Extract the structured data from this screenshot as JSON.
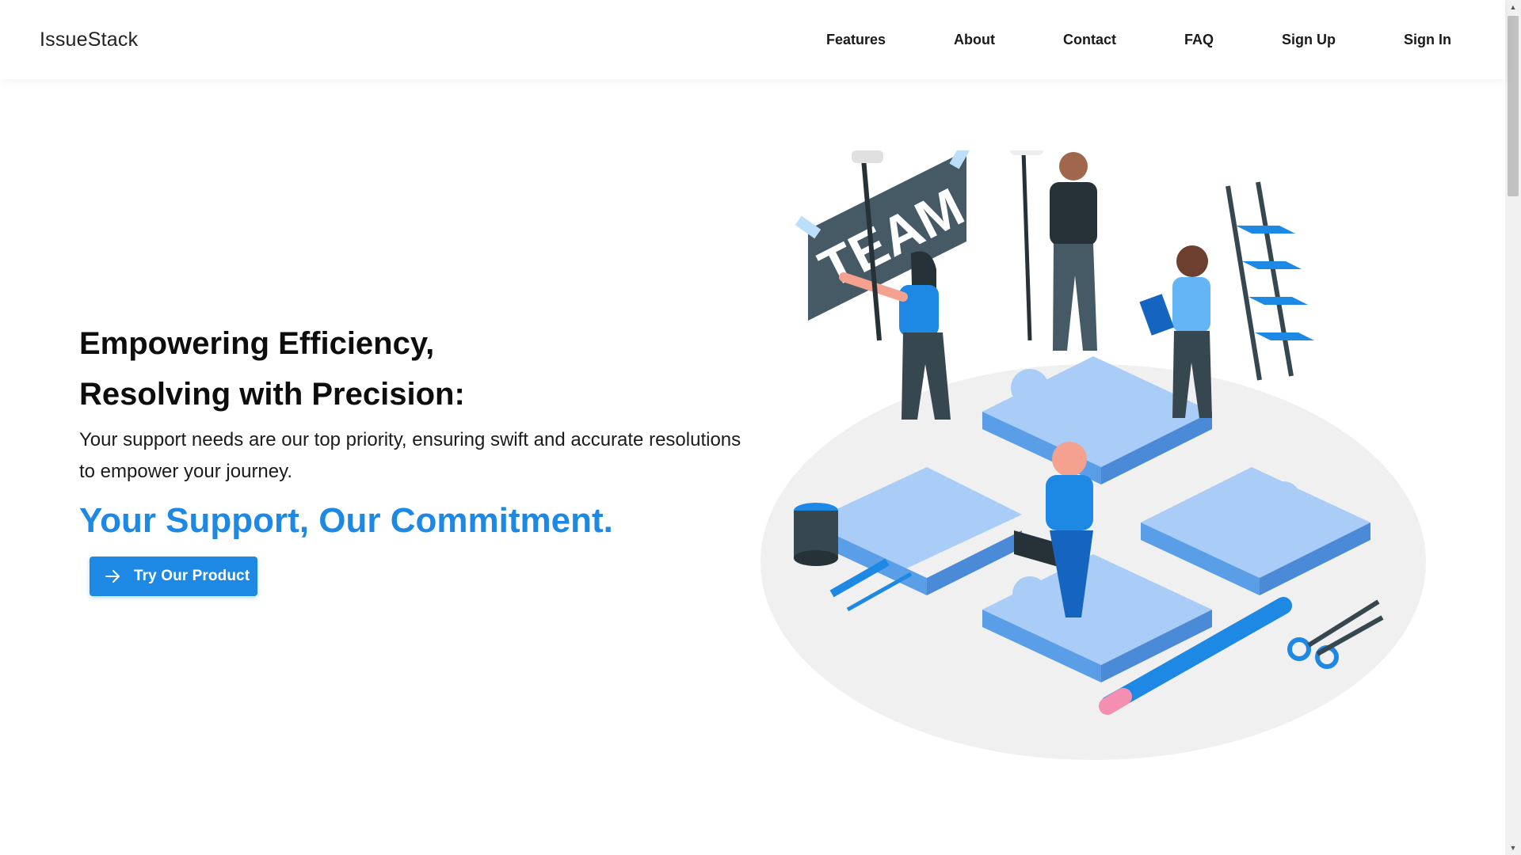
{
  "brand": {
    "name": "IssueStack"
  },
  "nav": {
    "items": [
      {
        "label": "Features"
      },
      {
        "label": "About"
      },
      {
        "label": "Contact"
      },
      {
        "label": "FAQ"
      },
      {
        "label": "Sign Up"
      },
      {
        "label": "Sign In"
      }
    ]
  },
  "hero": {
    "title_line1": "Empowering Efficiency,",
    "title_line2": "Resolving with Precision:",
    "description": "Your support needs are our top priority, ensuring swift and accurate resolutions to empower your journey.",
    "tagline": "Your Support, Our Commitment.",
    "cta_label": "Try Our Product"
  },
  "illustration": {
    "sign_text": "TEAM"
  },
  "colors": {
    "accent": "#1e88e5",
    "puzzle": "#a9cdf7",
    "dark": "#37474f"
  },
  "icons": [
    "arrow-right-icon"
  ]
}
